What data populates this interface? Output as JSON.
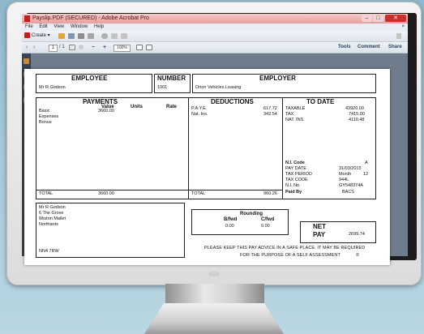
{
  "window": {
    "title": "Payslip.PDF (SECURED) - Adobe Acrobat Pro",
    "min": "–",
    "max": "□",
    "close": "✕"
  },
  "menu": {
    "items": [
      "File",
      "Edit",
      "View",
      "Window",
      "Help"
    ],
    "close_doc": "×"
  },
  "toolbar": {
    "create_label": "Create",
    "page_current": "1",
    "page_count": "/ 1",
    "zoom": "100%",
    "tools": "Tools",
    "comment": "Comment",
    "share": "Share"
  },
  "payslip": {
    "employee_header": "EMPLOYEE",
    "employee_name": "Mr R Godson",
    "number_header": "NUMBER",
    "number_value": "1001",
    "employer_header": "EMPLOYER",
    "employer_name": "Orion Vehicles Leasing",
    "payments": {
      "header": "PAYMENTS",
      "col_value": "Value",
      "col_units": "Units",
      "col_rate": "Rate",
      "items": [
        "Basic",
        "Expenses",
        "Bonus"
      ],
      "basic_value": "3660.00",
      "total_label": "TOTAL",
      "total_value": "3660.00"
    },
    "deductions": {
      "header": "DEDUCTIONS",
      "items": [
        "P.A.Y.E.",
        "Nat. Ins."
      ],
      "values": [
        "617.72",
        "342.54"
      ],
      "total_label": "TOTAL",
      "total_value": "960.26"
    },
    "to_date": {
      "header": "TO DATE",
      "labels": [
        "TAXABLE",
        "TAX",
        "NAT. INS."
      ],
      "values": [
        "43920.00",
        "7415.00",
        "4110.48"
      ],
      "ni_code_label": "N.I. Code",
      "ni_code_value": "A",
      "pay_date_label": "PAY DATE",
      "pay_date_value": "31/03/2015",
      "tax_period_label": "TAX PERIOD",
      "tax_period_unit": "Month",
      "tax_period_value": "12",
      "tax_code_label": "TAX CODE",
      "tax_code_value": "944L",
      "ni_no_label": "N.I. No.",
      "ni_no_value": "GY548374A",
      "paid_by_label": "Paid By",
      "paid_by_value": "BACS"
    },
    "address": [
      "Mr R Godson",
      "6 The Grove",
      "Wiston Mallet",
      "Northants"
    ],
    "postcode": "NN4 7RW",
    "rounding": {
      "header": "Rounding",
      "bfwd_label": "B/fwd",
      "cfwd_label": "C/fwd",
      "bfwd": "0.00",
      "cfwd": "0.00"
    },
    "net_pay": {
      "label1": "NET",
      "label2": "PAY",
      "value": "2699.74"
    },
    "notice_line1": "PLEASE KEEP THIS PAY ADVICE IN A SAFE PLACE. IT MAY BE REQUIRED",
    "notice_line2": "FOR THE PURPOSE OF A SELF ASSESSMENT",
    "copyright": "©"
  }
}
